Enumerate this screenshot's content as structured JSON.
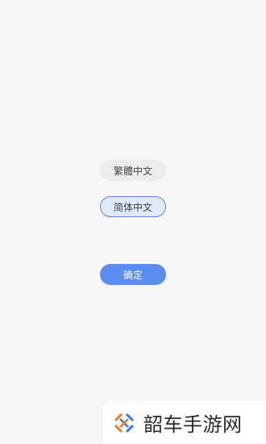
{
  "language_options": [
    {
      "label": "繁體中文",
      "selected": false
    },
    {
      "label": "简体中文",
      "selected": true
    }
  ],
  "actions": {
    "confirm_label": "确定"
  },
  "watermark": {
    "text": "韶车手游网",
    "icon": "diamond-cross-logo-icon"
  },
  "colors": {
    "background": "#f6f6f6",
    "primary": "#5b8df0",
    "selected_border": "#5b84e6",
    "selected_fill": "#dfe9fb",
    "unselected_fill": "#ececec",
    "logo_orange": "#ef7f2a",
    "logo_blue": "#3a7fe6"
  }
}
